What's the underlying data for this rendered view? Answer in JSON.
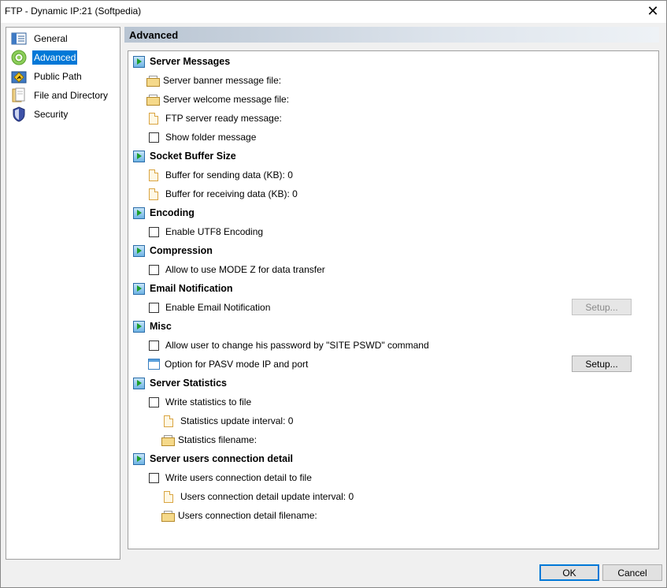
{
  "window": {
    "title": "FTP - Dynamic IP:21 (Softpedia)"
  },
  "sidebar": {
    "items": [
      {
        "label": "General",
        "icon": "general-icon"
      },
      {
        "label": "Advanced",
        "icon": "gear-icon",
        "selected": true
      },
      {
        "label": "Public Path",
        "icon": "public-path-icon"
      },
      {
        "label": "File and Directory",
        "icon": "file-directory-icon"
      },
      {
        "label": "Security",
        "icon": "shield-icon"
      }
    ]
  },
  "panel": {
    "title": "Advanced",
    "sections": {
      "server_messages": {
        "title": "Server Messages",
        "banner_file": "Server banner message file:",
        "welcome_file": "Server welcome message file:",
        "ready_message": "FTP server ready message:",
        "show_folder": "Show folder message"
      },
      "socket_buffer": {
        "title": "Socket Buffer Size",
        "sending": "Buffer for sending data (KB): 0",
        "receiving": "Buffer for receiving data (KB): 0"
      },
      "encoding": {
        "title": "Encoding",
        "utf8": "Enable UTF8 Encoding"
      },
      "compression": {
        "title": "Compression",
        "mode_z": "Allow to use MODE Z for data transfer"
      },
      "email": {
        "title": "Email Notification",
        "enable": "Enable Email Notification",
        "setup": "Setup..."
      },
      "misc": {
        "title": "Misc",
        "site_pswd": "Allow user to change his password by \"SITE PSWD\" command",
        "pasv": "Option for PASV mode IP and port",
        "setup": "Setup..."
      },
      "statistics": {
        "title": "Server Statistics",
        "write": "Write statistics to file",
        "interval": "Statistics update interval: 0",
        "filename": "Statistics filename:"
      },
      "connection": {
        "title": "Server users connection detail",
        "write": "Write users connection detail to file",
        "interval": "Users connection detail update interval: 0",
        "filename": "Users connection detail filename:"
      }
    }
  },
  "footer": {
    "ok": "OK",
    "cancel": "Cancel"
  }
}
